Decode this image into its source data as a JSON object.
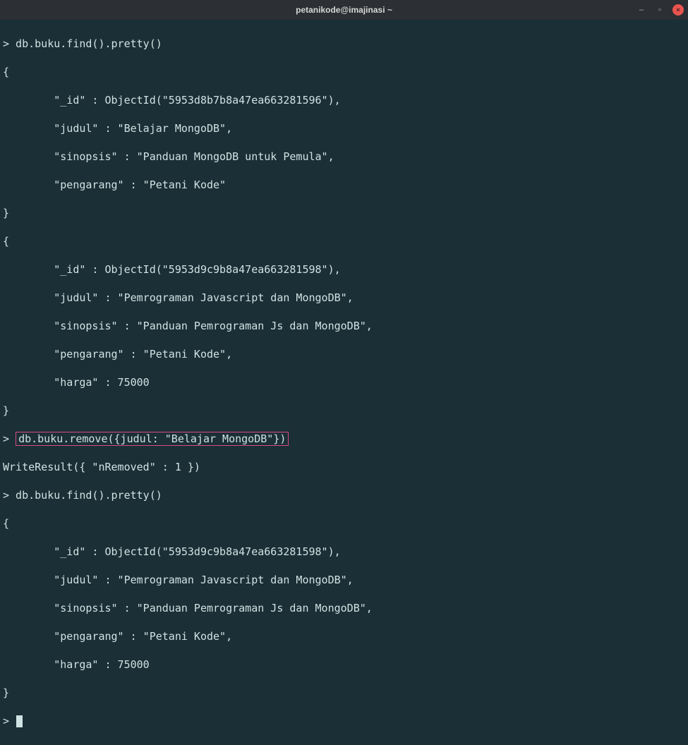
{
  "window": {
    "title": "petanikode@imajinasi ~"
  },
  "term": {
    "l01": "> db.buku.find().pretty()",
    "l02": "{",
    "l03": "        \"_id\" : ObjectId(\"5953d8b7b8a47ea663281596\"),",
    "l04": "        \"judul\" : \"Belajar MongoDB\",",
    "l05": "        \"sinopsis\" : \"Panduan MongoDB untuk Pemula\",",
    "l06": "        \"pengarang\" : \"Petani Kode\"",
    "l07": "}",
    "l08": "{",
    "l09": "        \"_id\" : ObjectId(\"5953d9c9b8a47ea663281598\"),",
    "l10": "        \"judul\" : \"Pemrograman Javascript dan MongoDB\",",
    "l11": "        \"sinopsis\" : \"Panduan Pemrograman Js dan MongoDB\",",
    "l12": "        \"pengarang\" : \"Petani Kode\",",
    "l13": "        \"harga\" : 75000",
    "l14": "}",
    "l15_prompt": "> ",
    "l15_cmd": "db.buku.remove({judul: \"Belajar MongoDB\"})",
    "l16": "WriteResult({ \"nRemoved\" : 1 })",
    "l17": "> db.buku.find().pretty()",
    "l18": "{",
    "l19": "        \"_id\" : ObjectId(\"5953d9c9b8a47ea663281598\"),",
    "l20": "        \"judul\" : \"Pemrograman Javascript dan MongoDB\",",
    "l21": "        \"sinopsis\" : \"Panduan Pemrograman Js dan MongoDB\",",
    "l22": "        \"pengarang\" : \"Petani Kode\",",
    "l23": "        \"harga\" : 75000",
    "l24": "}",
    "l25": "> "
  }
}
